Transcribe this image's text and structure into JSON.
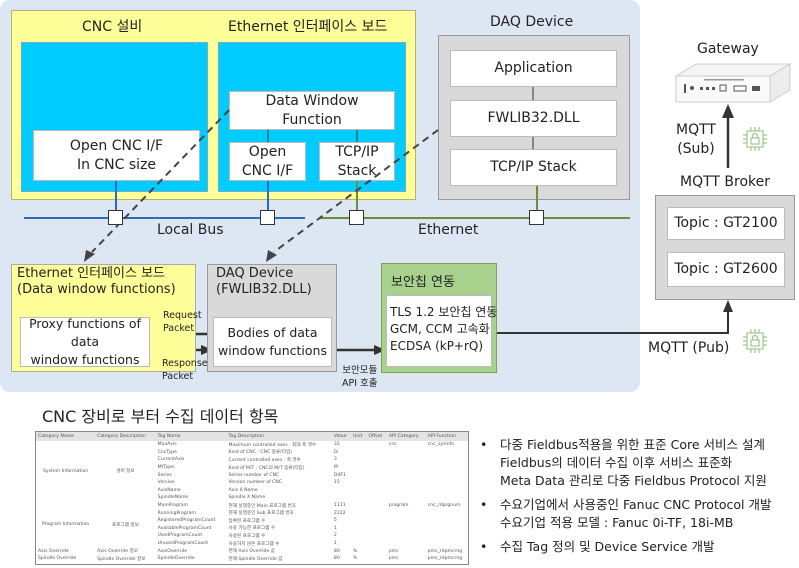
{
  "top": {
    "cnc_title": "CNC 설비",
    "eth_title": "Ethernet 인터페이스 보드",
    "open_cnc_size": [
      "Open CNC I/F",
      "In CNC size"
    ],
    "data_window": [
      "Data Window",
      "Function"
    ],
    "open_cnc": [
      "Open",
      "CNC I/F"
    ],
    "tcpip": [
      "TCP/IP",
      "Stack"
    ],
    "local_bus": "Local Bus",
    "ethernet": "Ethernet",
    "daq_title": "DAQ Device",
    "daq_items": [
      "Application",
      "FWLIB32.DLL",
      "TCP/IP Stack"
    ]
  },
  "bottom": {
    "eth_board": [
      "Ethernet 인터페이스 보드",
      "(Data window functions)"
    ],
    "proxy": [
      "Proxy functions of data",
      "window functions"
    ],
    "daq": [
      "DAQ Device",
      "(FWLIB32.DLL)"
    ],
    "bodies": [
      "Bodies of data",
      "window functions"
    ],
    "request": [
      "Request",
      "Packet"
    ],
    "response": [
      "Response",
      "Packet"
    ],
    "api_call": [
      "보안모듈",
      "API 호출"
    ],
    "security_title": "보안칩 연동",
    "security": [
      "TLS 1.2 보안칩 연동",
      "GCM, CCM 고속화",
      "ECDSA (kP+rQ)"
    ]
  },
  "right": {
    "gateway": "Gateway",
    "mqtt_sub": [
      "MQTT",
      "(Sub)"
    ],
    "broker": "MQTT Broker",
    "topics": [
      "Topic : GT2100",
      "Topic : GT2600"
    ],
    "mqtt_pub": "MQTT (Pub)"
  },
  "table_title": "CNC 장비로 부터 수집 데이터 항목",
  "table": {
    "headers": [
      "Category Name",
      "Category Description",
      "Tag Name",
      "Tag Description",
      "Value",
      "Unit",
      "Offset",
      "API Category",
      "API Function"
    ],
    "groups": [
      {
        "name": "System Information",
        "desc": "설비 정보",
        "rows": [
          [
            "MaxAxis",
            "Maximum controlled axes : 최대 축 갯수",
            "32",
            "",
            "",
            "cnc",
            "cnc_sysinfo"
          ],
          [
            "CncType",
            "Kind of CNC : CNC 종류(타입)",
            "0i",
            "",
            "",
            "",
            ""
          ],
          [
            "CurrentAxis",
            "Current controlled axes : 축 갯수",
            "3",
            "",
            "",
            "",
            ""
          ],
          [
            "MtType",
            "Kind of M/T : CNC의 M/T 종류(타입)",
            "M",
            "",
            "",
            "",
            ""
          ],
          [
            "Series",
            "Series number of CNC",
            "D4F1",
            "",
            "",
            "",
            ""
          ],
          [
            "Version",
            "Version number of CNC",
            "15",
            "",
            "",
            "",
            ""
          ],
          [
            "AxisName",
            "Axis X Name",
            "",
            "",
            "",
            "",
            ""
          ],
          [
            "SpindleName",
            "Spindle X Name",
            "",
            "",
            "",
            "",
            ""
          ]
        ]
      },
      {
        "name": "Program Information",
        "desc": "프로그램 정보",
        "rows": [
          [
            "MainProgram",
            "현재 실행중인 Main 프로그램 번호",
            "1111",
            "",
            "",
            "program",
            "cnc_rdprgnum"
          ],
          [
            "RunningProgram",
            "현재 실행중인 Sub 프로그램 번호",
            "2222",
            "",
            "",
            "",
            ""
          ],
          [
            "RegisteredProgramCount",
            "등록된 프로그램 수",
            "5",
            "",
            "",
            "",
            ""
          ],
          [
            "AvailableProgramCount",
            "사용 가능한 프로그램 수",
            "1",
            "",
            "",
            "",
            ""
          ],
          [
            "UsedProgramCount",
            "사용된 프로그램 수",
            "2",
            "",
            "",
            "",
            ""
          ],
          [
            "UnusedProgramCount",
            "사용하지 않은 프로그램 수",
            "1",
            "",
            "",
            "",
            ""
          ]
        ]
      },
      {
        "name": "Axis Override",
        "desc": "Axis Override 정보",
        "rows": [
          [
            "AxisOverride",
            "현재 Axis Override 값",
            "80",
            "%",
            "",
            "pmc",
            "pmc_rdpmcrng"
          ]
        ]
      },
      {
        "name": "Spindle Override",
        "desc": "Spindle Override 정보",
        "rows": [
          [
            "SpindleOverride",
            "현재 Spindle Override 값",
            "80",
            "%",
            "",
            "pmc",
            "pmc_rdpmcrng"
          ]
        ]
      }
    ]
  },
  "bullets": [
    [
      "다중 Fieldbus적용을 위한 표준 Core 서비스 설계",
      "Fieldbus의 데이터 수집 이후 서비스 표준화",
      "Meta Data 관리로 다중 Fieldbus Protocol 지원"
    ],
    [
      "수요기업에서 사용중인 Fanuc CNC Protocol 개발",
      "수요기업 적용 모델 : Fanuc 0i-TF, 18i-MB"
    ],
    [
      "수집 Tag 정의 및 Device Service 개발"
    ]
  ],
  "colors": {
    "panel": "#dde7f3",
    "yellow": "#ffff99",
    "cyan": "#00ccff",
    "gray": "#d9d9d9",
    "green": "#a9d18e",
    "local_bus": "#2e6db4",
    "ethernet": "#6b8e3a"
  }
}
